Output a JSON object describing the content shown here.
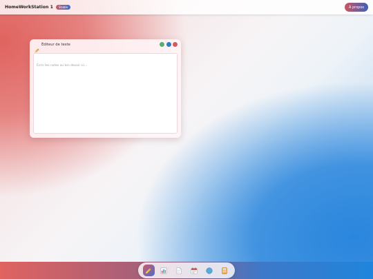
{
  "topbar": {
    "title": "HomeWorkStation 1",
    "badge": "Stable",
    "about_label": "À propos"
  },
  "editor_window": {
    "icon": "pencil-icon",
    "title": "Éditeur de texte",
    "controls": [
      "minimize-dot-green",
      "maximize-dot-blue",
      "close-dot-red"
    ],
    "placeholder": "Écris tes notes ou ton devoir ici..."
  },
  "dock": {
    "items": [
      {
        "icon": "pencil-icon",
        "active": true
      },
      {
        "icon": "bar-chart-icon",
        "active": false
      },
      {
        "icon": "document-icon",
        "active": false
      },
      {
        "icon": "calendar-icon",
        "active": false
      },
      {
        "icon": "globe-icon",
        "active": false
      },
      {
        "icon": "calculator-icon",
        "active": false
      }
    ]
  },
  "colors": {
    "accent_red": "#e0635f",
    "accent_blue": "#1f85dc",
    "control_green": "#57b06a",
    "control_blue": "#2e7ec2",
    "control_red": "#d45a5d"
  }
}
